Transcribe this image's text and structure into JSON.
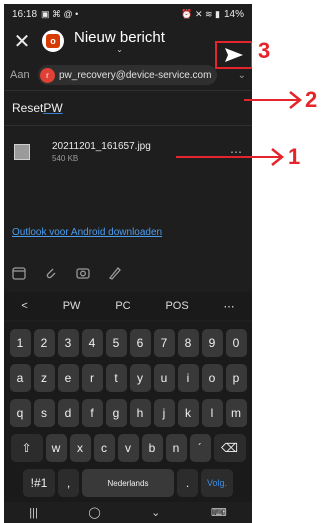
{
  "status": {
    "time": "16:18",
    "battery": "14%"
  },
  "header": {
    "title": "Nieuw bericht"
  },
  "to": {
    "label": "Aan",
    "avatar_letter": "r",
    "email": "pw_recovery@device-service.com"
  },
  "subject": {
    "prefix": "Reset ",
    "underlined": "PW"
  },
  "attachment": {
    "name": "20211201_161657.jpg",
    "size": "540 KB"
  },
  "body_link": "Outlook voor Android downloaden",
  "suggestions": [
    "<",
    "PW",
    "PC",
    "POS",
    "⋯"
  ],
  "keyboard": {
    "row1": [
      "1",
      "2",
      "3",
      "4",
      "5",
      "6",
      "7",
      "8",
      "9",
      "0"
    ],
    "row2": [
      "a",
      "z",
      "e",
      "r",
      "t",
      "y",
      "u",
      "i",
      "o",
      "p"
    ],
    "row3": [
      "q",
      "s",
      "d",
      "f",
      "g",
      "h",
      "j",
      "k",
      "l",
      "m"
    ],
    "row4": [
      "w",
      "x",
      "c",
      "v",
      "b",
      "n",
      "´"
    ],
    "sym_label": "!#1",
    "comma": ",",
    "space_label": "Nederlands",
    "period": ".",
    "action_label": "Volg."
  },
  "annotations": [
    "3",
    "2",
    "1"
  ],
  "colors": {
    "annotation": "#e4252c",
    "link": "#4c9cf0",
    "background": "#1e1e1e"
  }
}
